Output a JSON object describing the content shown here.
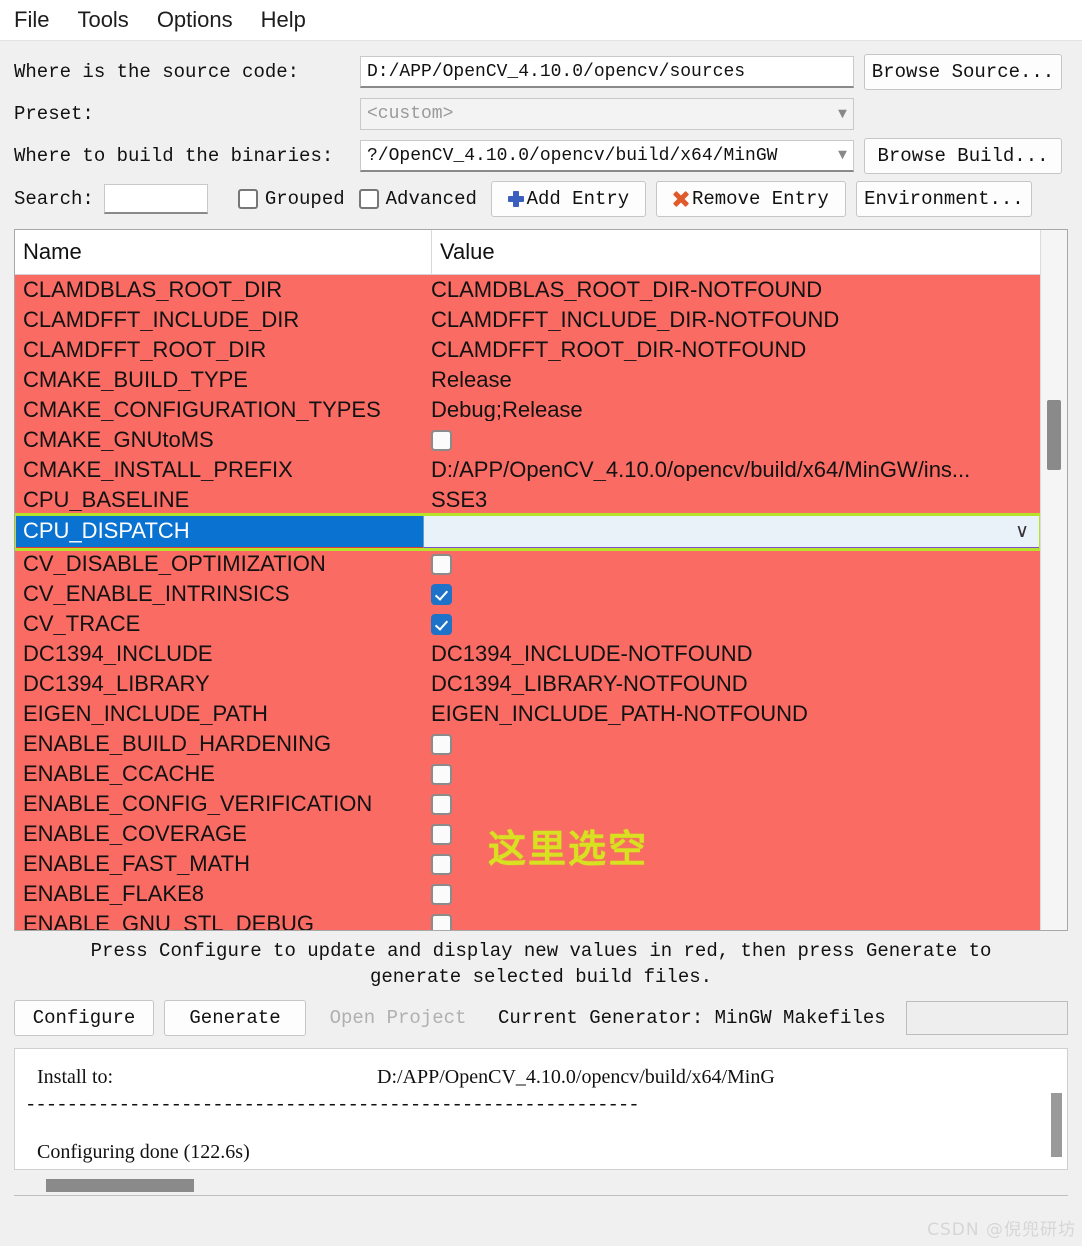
{
  "menubar": {
    "items": [
      {
        "label": "File"
      },
      {
        "label": "Tools"
      },
      {
        "label": "Options"
      },
      {
        "label": "Help"
      }
    ]
  },
  "form": {
    "source_label": "Where is the source code:",
    "source_value": "D:/APP/OpenCV_4.10.0/opencv/sources",
    "browse_source_label": "Browse Source...",
    "preset_label": "Preset:",
    "preset_value": "<custom>",
    "build_label": "Where to build the binaries:",
    "build_value": "?/OpenCV_4.10.0/opencv/build/x64/MinGW",
    "browse_build_label": "Browse Build...",
    "search_label": "Search:",
    "search_value": "",
    "grouped_label": "Grouped",
    "grouped_checked": false,
    "advanced_label": "Advanced",
    "advanced_checked": false,
    "add_entry_label": "Add Entry",
    "remove_entry_label": "Remove Entry",
    "environment_label": "Environment..."
  },
  "table": {
    "columns": [
      "Name",
      "Value"
    ],
    "rows": [
      {
        "name": "CLAMDBLAS_ROOT_DIR",
        "type": "text",
        "value": "CLAMDBLAS_ROOT_DIR-NOTFOUND"
      },
      {
        "name": "CLAMDFFT_INCLUDE_DIR",
        "type": "text",
        "value": "CLAMDFFT_INCLUDE_DIR-NOTFOUND"
      },
      {
        "name": "CLAMDFFT_ROOT_DIR",
        "type": "text",
        "value": "CLAMDFFT_ROOT_DIR-NOTFOUND"
      },
      {
        "name": "CMAKE_BUILD_TYPE",
        "type": "text",
        "value": "Release"
      },
      {
        "name": "CMAKE_CONFIGURATION_TYPES",
        "type": "text",
        "value": "Debug;Release"
      },
      {
        "name": "CMAKE_GNUtoMS",
        "type": "checkbox",
        "checked": false,
        "value": ""
      },
      {
        "name": "CMAKE_INSTALL_PREFIX",
        "type": "text",
        "value": "D:/APP/OpenCV_4.10.0/opencv/build/x64/MinGW/ins..."
      },
      {
        "name": "CPU_BASELINE",
        "type": "text",
        "value": "SSE3"
      },
      {
        "name": "CPU_DISPATCH",
        "type": "combo",
        "value": "",
        "selected": true
      },
      {
        "name": "CV_DISABLE_OPTIMIZATION",
        "type": "checkbox",
        "checked": false,
        "value": ""
      },
      {
        "name": "CV_ENABLE_INTRINSICS",
        "type": "checkbox",
        "checked": true,
        "value": ""
      },
      {
        "name": "CV_TRACE",
        "type": "checkbox",
        "checked": true,
        "value": ""
      },
      {
        "name": "DC1394_INCLUDE",
        "type": "text",
        "value": "DC1394_INCLUDE-NOTFOUND"
      },
      {
        "name": "DC1394_LIBRARY",
        "type": "text",
        "value": "DC1394_LIBRARY-NOTFOUND"
      },
      {
        "name": "EIGEN_INCLUDE_PATH",
        "type": "text",
        "value": "EIGEN_INCLUDE_PATH-NOTFOUND"
      },
      {
        "name": "ENABLE_BUILD_HARDENING",
        "type": "checkbox",
        "checked": false,
        "value": ""
      },
      {
        "name": "ENABLE_CCACHE",
        "type": "checkbox",
        "checked": false,
        "value": ""
      },
      {
        "name": "ENABLE_CONFIG_VERIFICATION",
        "type": "checkbox",
        "checked": false,
        "value": ""
      },
      {
        "name": "ENABLE_COVERAGE",
        "type": "checkbox",
        "checked": false,
        "value": ""
      },
      {
        "name": "ENABLE_FAST_MATH",
        "type": "checkbox",
        "checked": false,
        "value": ""
      },
      {
        "name": "ENABLE_FLAKE8",
        "type": "checkbox",
        "checked": false,
        "value": ""
      },
      {
        "name": "ENABLE_GNU_STL_DEBUG",
        "type": "checkbox",
        "checked": false,
        "value": ""
      }
    ]
  },
  "annotation": {
    "text": "这里选空",
    "color": "#d9e021"
  },
  "hint": {
    "line1": "Press Configure to update and display new values in red, then press Generate to",
    "line2": "generate selected build files."
  },
  "actions": {
    "configure_label": "Configure",
    "generate_label": "Generate",
    "open_project_label": "Open Project",
    "generator_label": "Current Generator: MinGW Makefiles",
    "generator_field_value": ""
  },
  "log": {
    "line_install_label": "Install to:",
    "line_install_value": "D:/APP/OpenCV_4.10.0/opencv/build/x64/MinG",
    "line_dashes": "-----------------------------------------------------------",
    "line_status": "Configuring done (122.6s)"
  },
  "watermark": {
    "text": "CSDN @倪兜研坊"
  },
  "colors": {
    "row_red": "#fa6b63",
    "selection_blue": "#0a72d0",
    "annotation_green": "#d9e021",
    "highlight_outline": "#b6e22a"
  }
}
